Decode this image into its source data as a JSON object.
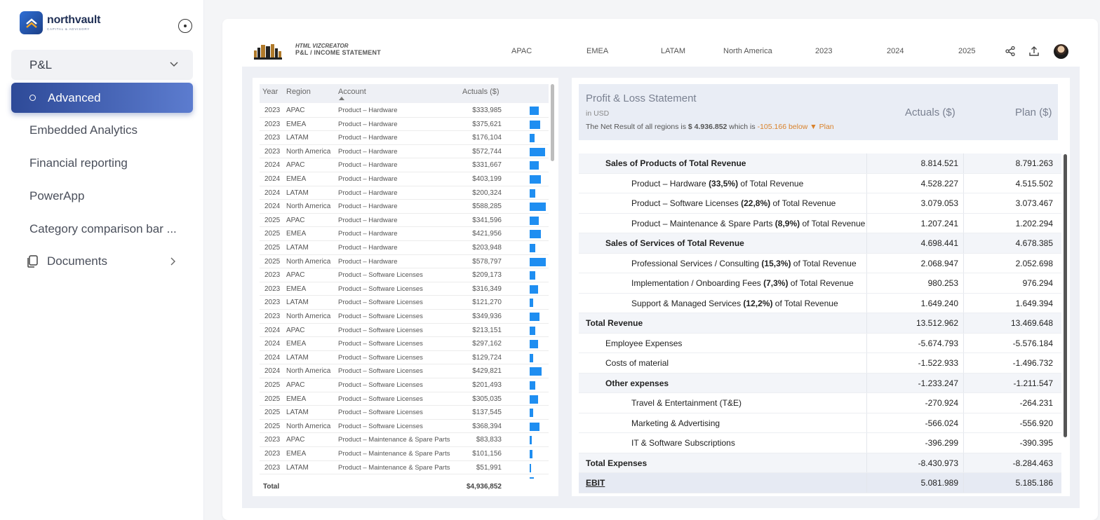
{
  "sidebar": {
    "brand_name": "northvault",
    "brand_tagline": "CAPITAL & ADVISORY",
    "group_label": "P&L",
    "active_item": "Advanced",
    "items": [
      {
        "label": "Embedded Analytics"
      },
      {
        "label": "Financial reporting"
      },
      {
        "label": "PowerApp"
      },
      {
        "label": "Category comparison bar ..."
      }
    ],
    "documents_label": "Documents"
  },
  "report": {
    "kicker": "HTML VIZCREATOR",
    "title": "P&L / INCOME STATEMENT",
    "filters": [
      "APAC",
      "EMEA",
      "LATAM",
      "North America",
      "2023",
      "2024",
      "2025"
    ]
  },
  "left_table": {
    "columns": [
      "Year",
      "Region",
      "Account",
      "Actuals ($)"
    ],
    "rows": [
      {
        "year": "2023",
        "region": "APAC",
        "account": "Product – Hardware",
        "actual": "$333,985",
        "value": 333985
      },
      {
        "year": "2023",
        "region": "EMEA",
        "account": "Product – Hardware",
        "actual": "$375,621",
        "value": 375621
      },
      {
        "year": "2023",
        "region": "LATAM",
        "account": "Product – Hardware",
        "actual": "$176,104",
        "value": 176104
      },
      {
        "year": "2023",
        "region": "North America",
        "account": "Product – Hardware",
        "actual": "$572,744",
        "value": 572744
      },
      {
        "year": "2024",
        "region": "APAC",
        "account": "Product – Hardware",
        "actual": "$331,667",
        "value": 331667
      },
      {
        "year": "2024",
        "region": "EMEA",
        "account": "Product – Hardware",
        "actual": "$403,199",
        "value": 403199
      },
      {
        "year": "2024",
        "region": "LATAM",
        "account": "Product – Hardware",
        "actual": "$200,324",
        "value": 200324
      },
      {
        "year": "2024",
        "region": "North America",
        "account": "Product – Hardware",
        "actual": "$588,285",
        "value": 588285
      },
      {
        "year": "2025",
        "region": "APAC",
        "account": "Product – Hardware",
        "actual": "$341,596",
        "value": 341596
      },
      {
        "year": "2025",
        "region": "EMEA",
        "account": "Product – Hardware",
        "actual": "$421,956",
        "value": 421956
      },
      {
        "year": "2025",
        "region": "LATAM",
        "account": "Product – Hardware",
        "actual": "$203,948",
        "value": 203948
      },
      {
        "year": "2025",
        "region": "North America",
        "account": "Product – Hardware",
        "actual": "$578,797",
        "value": 578797
      },
      {
        "year": "2023",
        "region": "APAC",
        "account": "Product – Software Licenses",
        "actual": "$209,173",
        "value": 209173
      },
      {
        "year": "2023",
        "region": "EMEA",
        "account": "Product – Software Licenses",
        "actual": "$316,349",
        "value": 316349
      },
      {
        "year": "2023",
        "region": "LATAM",
        "account": "Product – Software Licenses",
        "actual": "$121,270",
        "value": 121270
      },
      {
        "year": "2023",
        "region": "North America",
        "account": "Product – Software Licenses",
        "actual": "$349,936",
        "value": 349936
      },
      {
        "year": "2024",
        "region": "APAC",
        "account": "Product – Software Licenses",
        "actual": "$213,151",
        "value": 213151
      },
      {
        "year": "2024",
        "region": "EMEA",
        "account": "Product – Software Licenses",
        "actual": "$297,162",
        "value": 297162
      },
      {
        "year": "2024",
        "region": "LATAM",
        "account": "Product – Software Licenses",
        "actual": "$129,724",
        "value": 129724
      },
      {
        "year": "2024",
        "region": "North America",
        "account": "Product – Software Licenses",
        "actual": "$429,821",
        "value": 429821
      },
      {
        "year": "2025",
        "region": "APAC",
        "account": "Product – Software Licenses",
        "actual": "$201,493",
        "value": 201493
      },
      {
        "year": "2025",
        "region": "EMEA",
        "account": "Product – Software Licenses",
        "actual": "$305,035",
        "value": 305035
      },
      {
        "year": "2025",
        "region": "LATAM",
        "account": "Product – Software Licenses",
        "actual": "$137,545",
        "value": 137545
      },
      {
        "year": "2025",
        "region": "North America",
        "account": "Product – Software Licenses",
        "actual": "$368,394",
        "value": 368394
      },
      {
        "year": "2023",
        "region": "APAC",
        "account": "Product – Maintenance & Spare Parts",
        "actual": "$83,833",
        "value": 83833
      },
      {
        "year": "2023",
        "region": "EMEA",
        "account": "Product – Maintenance & Spare Parts",
        "actual": "$101,156",
        "value": 101156
      },
      {
        "year": "2023",
        "region": "LATAM",
        "account": "Product – Maintenance & Spare Parts",
        "actual": "$51,991",
        "value": 51991
      }
    ],
    "total_label": "Total",
    "total_value": "$4,936,852",
    "bar_color": "#1f8ef1"
  },
  "pl": {
    "title": "Profit & Loss Statement",
    "unit": "in USD",
    "summary_prefix": "The Net Result of all regions is",
    "summary_amount": "$ 4.936.852",
    "summary_mid": "which is",
    "summary_diff": "-105.166 below ▼ Plan",
    "col_actual": "Actuals ($)",
    "col_plan": "Plan ($)",
    "accent_color": "#d9822b",
    "rows": [
      {
        "label_pre": "Sales of Products of Total Revenue",
        "label_bold": "",
        "label_post": "",
        "actual": "8.814.521",
        "plan": "8.791.263",
        "level": "lvl1b",
        "shaded": true
      },
      {
        "label_pre": "Product – Hardware ",
        "label_bold": "(33,5%)",
        "label_post": " of Total Revenue",
        "actual": "4.528.227",
        "plan": "4.515.502",
        "level": "lvl2",
        "shaded": false
      },
      {
        "label_pre": "Product – Software Licenses ",
        "label_bold": "(22,8%)",
        "label_post": " of Total Revenue",
        "actual": "3.079.053",
        "plan": "3.073.467",
        "level": "lvl2",
        "shaded": false
      },
      {
        "label_pre": "Product – Maintenance & Spare Parts ",
        "label_bold": "(8,9%)",
        "label_post": " of Total Revenue",
        "actual": "1.207.241",
        "plan": "1.202.294",
        "level": "lvl2",
        "shaded": false
      },
      {
        "label_pre": "Sales of Services of Total Revenue",
        "label_bold": "",
        "label_post": "",
        "actual": "4.698.441",
        "plan": "4.678.385",
        "level": "lvl1b",
        "shaded": true
      },
      {
        "label_pre": "Professional Services / Consulting ",
        "label_bold": "(15,3%)",
        "label_post": " of Total Revenue",
        "actual": "2.068.947",
        "plan": "2.052.698",
        "level": "lvl2",
        "shaded": false
      },
      {
        "label_pre": "Implementation / Onboarding Fees ",
        "label_bold": "(7,3%)",
        "label_post": " of Total Revenue",
        "actual": "980.253",
        "plan": "976.294",
        "level": "lvl2",
        "shaded": false
      },
      {
        "label_pre": "Support & Managed Services ",
        "label_bold": "(12,2%)",
        "label_post": " of Total Revenue",
        "actual": "1.649.240",
        "plan": "1.649.394",
        "level": "lvl2",
        "shaded": false
      },
      {
        "label_pre": "Total Revenue",
        "label_bold": "",
        "label_post": "",
        "actual": "13.512.962",
        "plan": "13.469.648",
        "level": "lvl0",
        "shaded": true
      },
      {
        "label_pre": "Employee Expenses",
        "label_bold": "",
        "label_post": "",
        "actual": "-5.674.793",
        "plan": "-5.576.184",
        "level": "lvl1",
        "shaded": false
      },
      {
        "label_pre": "Costs of material",
        "label_bold": "",
        "label_post": "",
        "actual": "-1.522.933",
        "plan": "-1.496.732",
        "level": "lvl1",
        "shaded": false
      },
      {
        "label_pre": "Other expenses",
        "label_bold": "",
        "label_post": "",
        "actual": "-1.233.247",
        "plan": "-1.211.547",
        "level": "lvl1b",
        "shaded": true
      },
      {
        "label_pre": "Travel & Entertainment (T&E)",
        "label_bold": "",
        "label_post": "",
        "actual": "-270.924",
        "plan": "-264.231",
        "level": "lvl2",
        "shaded": false
      },
      {
        "label_pre": "Marketing & Advertising",
        "label_bold": "",
        "label_post": "",
        "actual": "-566.024",
        "plan": "-556.920",
        "level": "lvl2",
        "shaded": false
      },
      {
        "label_pre": "IT & Software Subscriptions",
        "label_bold": "",
        "label_post": "",
        "actual": "-396.299",
        "plan": "-390.395",
        "level": "lvl2",
        "shaded": false
      },
      {
        "label_pre": "Total Expenses",
        "label_bold": "",
        "label_post": "",
        "actual": "-8.430.973",
        "plan": "-8.284.463",
        "level": "lvl0",
        "shaded": true
      },
      {
        "label_pre": "EBIT",
        "label_bold": "",
        "label_post": "",
        "actual": "5.081.989",
        "plan": "5.185.186",
        "level": "ebit-lbl",
        "shaded": false,
        "ebit": true
      }
    ]
  },
  "icons": [
    "northvault-logo-icon",
    "collapse-sidebar-icon",
    "chevron-down-icon",
    "documents-icon",
    "chevron-right-icon",
    "brand-logo-icon",
    "share-icon",
    "upload-icon",
    "avatar"
  ]
}
